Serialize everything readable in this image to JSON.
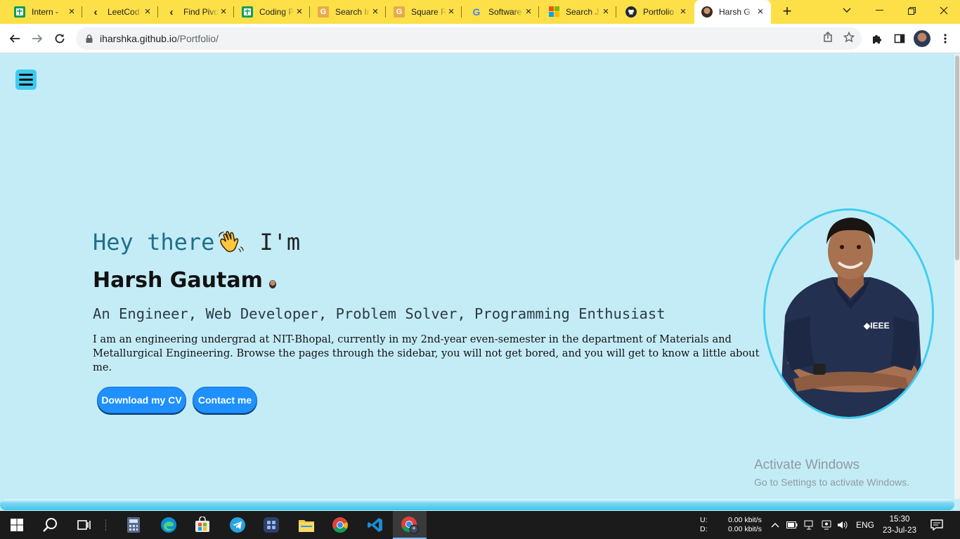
{
  "browser": {
    "tabs": [
      {
        "title": "Intern - ",
        "icon": "google-sheets-icon"
      },
      {
        "title": "LeetCod",
        "icon": "leetcode-icon"
      },
      {
        "title": "Find Pivo",
        "icon": "leetcode-icon"
      },
      {
        "title": "Coding P",
        "icon": "google-sheets-icon"
      },
      {
        "title": "Search In",
        "icon": "geeksforgeeks-icon"
      },
      {
        "title": "Square R",
        "icon": "geeksforgeeks-icon"
      },
      {
        "title": "Software",
        "icon": "google-icon"
      },
      {
        "title": "Search J",
        "icon": "microsoft-icon"
      },
      {
        "title": "Portfolio",
        "icon": "github-icon"
      },
      {
        "title": "Harsh G",
        "icon": "avatar-icon",
        "active": true
      }
    ],
    "url_host": "iharshka.github.io",
    "url_path": "/Portfolio/",
    "tabstrip_color": "#fde047"
  },
  "page": {
    "greeting": "Hey there",
    "greeting_suffix": "I'm",
    "name": "Harsh Gautam",
    "roles": "An Engineer, Web Developer, Problem Solver, Programming Enthusiast",
    "bio": "I am an engineering undergrad at NIT-Bhopal, currently in my 2nd-year even-semester in the department of Materials and Metallurgical Engineering. Browse the pages through the sidebar, you will not get bored, and you will get to know a little about me.",
    "buttons": {
      "download_cv": "Download my CV",
      "contact": "Contact me"
    },
    "background_color": "#c4ecf7",
    "accent_color": "#1e90ff"
  },
  "watermark": {
    "line1": "Activate Windows",
    "line2": "Go to Settings to activate Windows."
  },
  "taskbar": {
    "net_labels": [
      "U:",
      "D:"
    ],
    "net_values": [
      "0.00 kbit/s",
      "0.00 kbit/s"
    ],
    "language": "ENG",
    "time": "15:30",
    "date": "23-Jul-23"
  }
}
